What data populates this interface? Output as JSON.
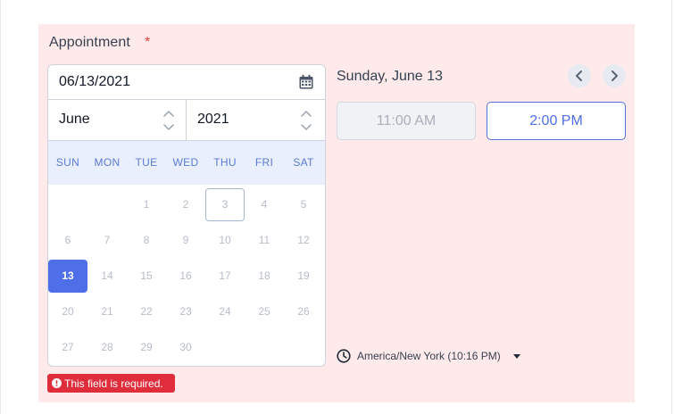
{
  "field": {
    "label": "Appointment",
    "required_mark": "*",
    "error": "This field is required."
  },
  "date_input": {
    "value": "06/13/2021"
  },
  "selectors": {
    "month": "June",
    "year": "2021"
  },
  "weekdays": [
    "SUN",
    "MON",
    "TUE",
    "WED",
    "THU",
    "FRI",
    "SAT"
  ],
  "days": [
    {
      "n": "1",
      "col": 2,
      "row": 0
    },
    {
      "n": "2",
      "col": 3,
      "row": 0
    },
    {
      "n": "3",
      "col": 4,
      "row": 0,
      "state": "today"
    },
    {
      "n": "4",
      "col": 5,
      "row": 0
    },
    {
      "n": "5",
      "col": 6,
      "row": 0
    },
    {
      "n": "6",
      "col": 0,
      "row": 1
    },
    {
      "n": "7",
      "col": 1,
      "row": 1
    },
    {
      "n": "8",
      "col": 2,
      "row": 1
    },
    {
      "n": "9",
      "col": 3,
      "row": 1
    },
    {
      "n": "10",
      "col": 4,
      "row": 1
    },
    {
      "n": "11",
      "col": 5,
      "row": 1
    },
    {
      "n": "12",
      "col": 6,
      "row": 1
    },
    {
      "n": "13",
      "col": 0,
      "row": 2,
      "state": "selected"
    },
    {
      "n": "14",
      "col": 1,
      "row": 2
    },
    {
      "n": "15",
      "col": 2,
      "row": 2
    },
    {
      "n": "16",
      "col": 3,
      "row": 2
    },
    {
      "n": "17",
      "col": 4,
      "row": 2
    },
    {
      "n": "18",
      "col": 5,
      "row": 2
    },
    {
      "n": "19",
      "col": 6,
      "row": 2
    },
    {
      "n": "20",
      "col": 0,
      "row": 3
    },
    {
      "n": "21",
      "col": 1,
      "row": 3
    },
    {
      "n": "22",
      "col": 2,
      "row": 3
    },
    {
      "n": "23",
      "col": 3,
      "row": 3
    },
    {
      "n": "24",
      "col": 4,
      "row": 3
    },
    {
      "n": "25",
      "col": 5,
      "row": 3
    },
    {
      "n": "26",
      "col": 6,
      "row": 3
    },
    {
      "n": "27",
      "col": 0,
      "row": 4
    },
    {
      "n": "28",
      "col": 1,
      "row": 4
    },
    {
      "n": "29",
      "col": 2,
      "row": 4
    },
    {
      "n": "30",
      "col": 3,
      "row": 4
    }
  ],
  "schedule": {
    "day_title": "Sunday, June 13",
    "slots": [
      "11:00 AM",
      "2:00 PM"
    ],
    "timezone": "America/New York (10:16 PM)"
  },
  "icons": {
    "calendar": "calendar-icon",
    "stepper": "up-down-chevron-icon",
    "prev": "chevron-left-icon",
    "next": "chevron-right-icon",
    "clock": "clock-icon",
    "caret": "caret-down-icon",
    "error": "alert-circle-icon"
  },
  "colors": {
    "panel_bg": "#feeaea",
    "accent": "#4f6fe8",
    "error": "#e02d3c",
    "weekday_bg": "#e9effc"
  }
}
